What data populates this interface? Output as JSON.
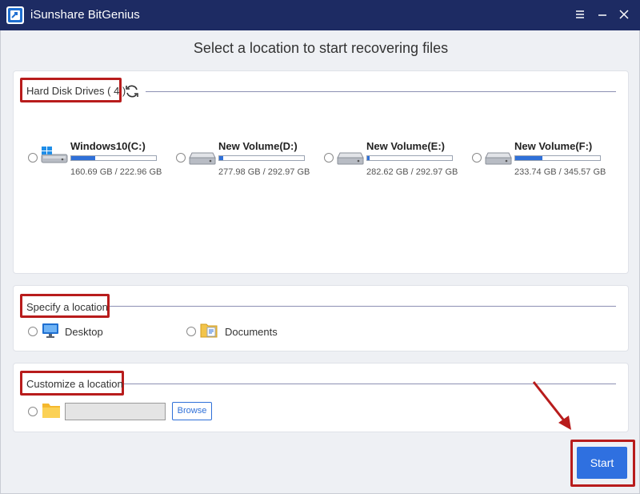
{
  "window": {
    "title": "iSunshare BitGenius",
    "controls": [
      "menu-icon",
      "minimize-icon",
      "close-icon"
    ]
  },
  "page": {
    "title": "Select a location to start recovering files"
  },
  "drives_section": {
    "label": "Hard Disk Drives ( 4 )",
    "drives": [
      {
        "name": "Windows10(C:)",
        "size": "160.69 GB / 222.96 GB",
        "used_fraction": 0.28,
        "icon": "windows-drive-icon"
      },
      {
        "name": "New Volume(D:)",
        "size": "277.98 GB / 292.97 GB",
        "used_fraction": 0.05,
        "icon": "hard-drive-icon"
      },
      {
        "name": "New Volume(E:)",
        "size": "282.62 GB / 292.97 GB",
        "used_fraction": 0.03,
        "icon": "hard-drive-icon"
      },
      {
        "name": "New Volume(F:)",
        "size": "233.74 GB / 345.57 GB",
        "used_fraction": 0.32,
        "icon": "hard-drive-icon"
      }
    ]
  },
  "specify_section": {
    "label": "Specify a location",
    "options": [
      {
        "label": "Desktop",
        "icon": "desktop-icon"
      },
      {
        "label": "Documents",
        "icon": "documents-icon"
      }
    ]
  },
  "custom_section": {
    "label": "Customize a location",
    "path_value": "",
    "browse_label": "Browse"
  },
  "actions": {
    "start_label": "Start"
  },
  "colors": {
    "titlebar": "#1d2b63",
    "accent": "#2f70e0",
    "highlight": "#b81c1c"
  }
}
